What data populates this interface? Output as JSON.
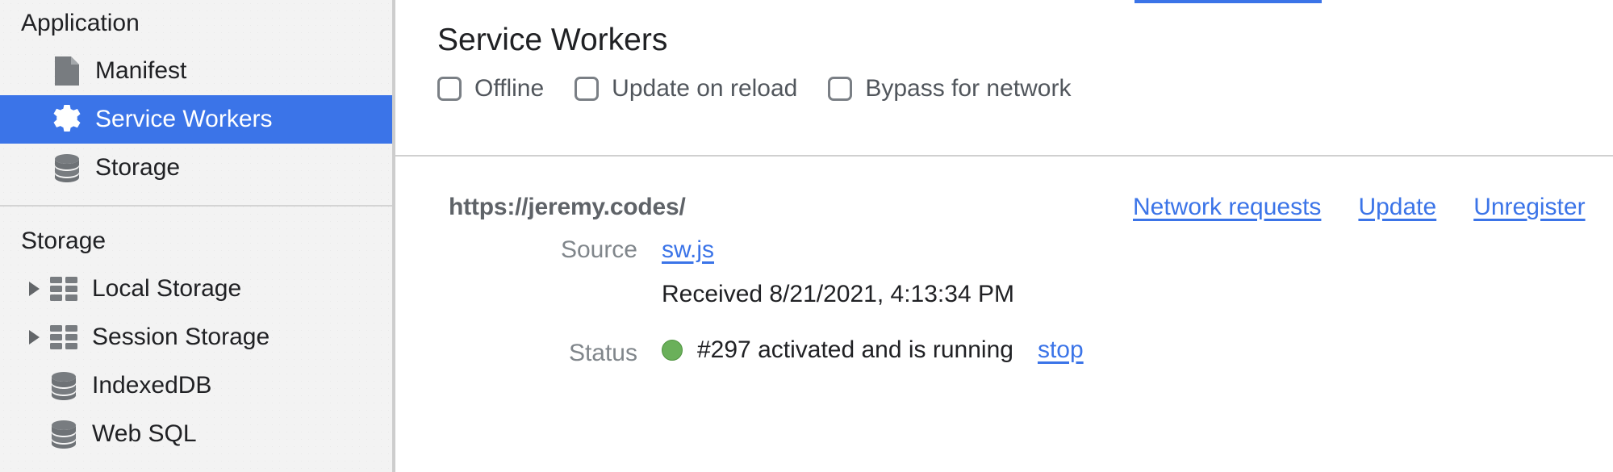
{
  "sidebar": {
    "sections": [
      {
        "title": "Application",
        "items": [
          {
            "label": "Manifest",
            "icon": "document-icon",
            "selected": false,
            "expandable": false
          },
          {
            "label": "Service Workers",
            "icon": "gear-icon",
            "selected": true,
            "expandable": false
          },
          {
            "label": "Storage",
            "icon": "database-icon",
            "selected": false,
            "expandable": false
          }
        ]
      },
      {
        "title": "Storage",
        "items": [
          {
            "label": "Local Storage",
            "icon": "table-icon",
            "selected": false,
            "expandable": true
          },
          {
            "label": "Session Storage",
            "icon": "table-icon",
            "selected": false,
            "expandable": true
          },
          {
            "label": "IndexedDB",
            "icon": "database-icon",
            "selected": false,
            "expandable": false
          },
          {
            "label": "Web SQL",
            "icon": "database-icon",
            "selected": false,
            "expandable": false
          }
        ]
      }
    ]
  },
  "main": {
    "title": "Service Workers",
    "checkboxes": [
      {
        "label": "Offline",
        "checked": false
      },
      {
        "label": "Update on reload",
        "checked": false
      },
      {
        "label": "Bypass for network",
        "checked": false
      }
    ],
    "registration": {
      "scope_url": "https://jeremy.codes/",
      "actions": [
        {
          "label": "Network requests"
        },
        {
          "label": "Update"
        },
        {
          "label": "Unregister"
        }
      ],
      "source_label": "Source",
      "source_file": "sw.js",
      "received_text": "Received 8/21/2021, 4:13:34 PM",
      "status_label": "Status",
      "status_text": "#297 activated and is running",
      "status_action": "stop",
      "status_color": "#6ab05a"
    }
  },
  "colors": {
    "selection_blue": "#3b74e8",
    "link_blue": "#3b74e8",
    "sidebar_bg": "#f3f3f3",
    "muted_text": "#80868b",
    "status_green": "#6ab05a"
  }
}
